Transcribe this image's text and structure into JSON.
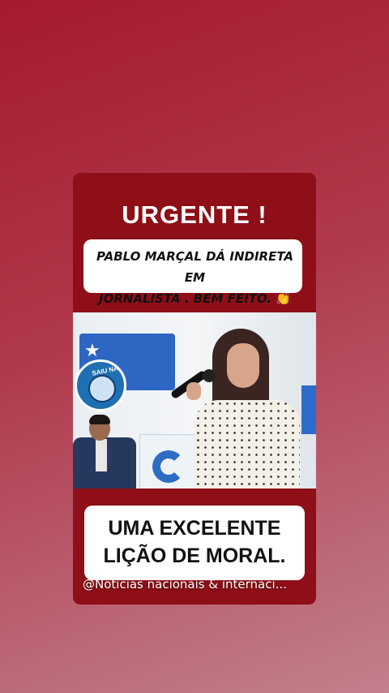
{
  "post": {
    "headline": "URGENTE !",
    "subtitle_line1": "PABLO MARÇAL DÁ INDIRETA EM",
    "subtitle_line2": "JORNALISTA . BEM FEITO.",
    "subtitle_emoji": "👏👏",
    "video": {
      "logo_text": "SAIU NA MÍDIA",
      "logo_icon": "eye-globe-icon"
    },
    "caption_line1": "UMA EXCELENTE",
    "caption_line2": "LIÇÃO DE MORAL.",
    "credit": "@Noticias nacionais & internaci..."
  },
  "colors": {
    "card_bg": "#8e0f17",
    "background_top": "#a51a2e",
    "background_bottom": "#c2808c",
    "accent_blue": "#2e66c4"
  }
}
